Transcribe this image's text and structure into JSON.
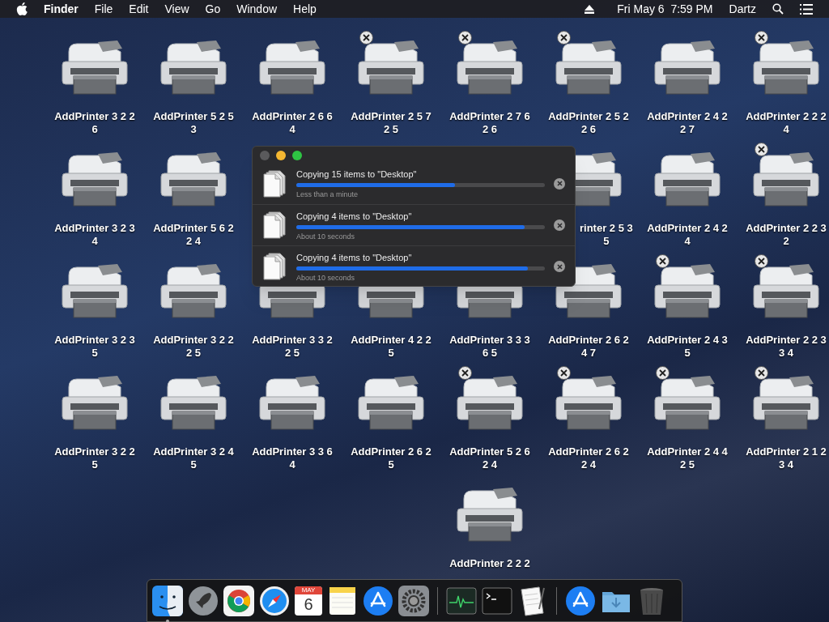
{
  "menu_bar": {
    "app": "Finder",
    "items": [
      "File",
      "Edit",
      "View",
      "Go",
      "Window",
      "Help"
    ],
    "clock": "Fri May 6  7:59 PM",
    "user": "Dartz"
  },
  "desktop": {
    "rows": [
      [
        {
          "label": [
            "AddPrinter 3 2 2",
            "6"
          ],
          "close_badge": false
        },
        {
          "label": [
            "AddPrinter 5 2 5",
            "3"
          ],
          "close_badge": false
        },
        {
          "label": [
            "AddPrinter 2 6 6",
            "4"
          ],
          "close_badge": false
        },
        {
          "label": [
            "AddPrinter 2 5 7",
            "2 5"
          ],
          "close_badge": true
        },
        {
          "label": [
            "AddPrinter 2 7 6",
            "2 6"
          ],
          "close_badge": true
        },
        {
          "label": [
            "AddPrinter 2 5 2",
            "2 6"
          ],
          "close_badge": true
        },
        {
          "label": [
            "AddPrinter 2 4 2",
            "2 7"
          ],
          "close_badge": false
        },
        {
          "label": [
            "AddPrinter 2 2 2",
            "4"
          ],
          "close_badge": true
        }
      ],
      [
        {
          "label": [
            "AddPrinter 3 2 3",
            "4"
          ],
          "close_badge": false
        },
        {
          "label": [
            "AddPrinter 5 6 2",
            "2 4"
          ],
          "close_badge": false
        },
        null,
        null,
        null,
        {
          "label": [
            "rinter 2 5 3",
            "5"
          ],
          "close_badge": false
        },
        {
          "label": [
            "AddPrinter 2 4 2",
            "4"
          ],
          "close_badge": false
        },
        {
          "label": [
            "AddPrinter 2 2 3",
            "2"
          ],
          "close_badge": true
        }
      ],
      [
        {
          "label": [
            "AddPrinter 3 2 3",
            "5"
          ],
          "close_badge": false
        },
        {
          "label": [
            "AddPrinter 3 2 2",
            "2 5"
          ],
          "close_badge": false
        },
        {
          "label": [
            "AddPrinter 3 3 2",
            "2 5"
          ],
          "close_badge": false
        },
        {
          "label": [
            "AddPrinter 4 2 2",
            "5"
          ],
          "close_badge": false
        },
        {
          "label": [
            "AddPrinter 3 3 3",
            "6 5"
          ],
          "close_badge": false
        },
        {
          "label": [
            "AddPrinter 2 6 2",
            "4 7"
          ],
          "close_badge": false
        },
        {
          "label": [
            "AddPrinter 2 4 3",
            "5"
          ],
          "close_badge": true
        },
        {
          "label": [
            "AddPrinter 2 2 3",
            "3 4"
          ],
          "close_badge": true
        }
      ],
      [
        {
          "label": [
            "AddPrinter 3 2 2",
            "5"
          ],
          "close_badge": false
        },
        {
          "label": [
            "AddPrinter 3 2 4",
            "5"
          ],
          "close_badge": false
        },
        {
          "label": [
            "AddPrinter 3 3 6",
            "4"
          ],
          "close_badge": false
        },
        {
          "label": [
            "AddPrinter 2 6 2",
            "5"
          ],
          "close_badge": false
        },
        {
          "label": [
            "AddPrinter 5 2 6",
            "2 4"
          ],
          "close_badge": true
        },
        {
          "label": [
            "AddPrinter 2 6 2",
            "2 4"
          ],
          "close_badge": true
        },
        {
          "label": [
            "AddPrinter 2 4 4",
            "2 5"
          ],
          "close_badge": true
        },
        {
          "label": [
            "AddPrinter 2 1 2",
            "3 4"
          ],
          "close_badge": true
        }
      ],
      [
        null,
        null,
        null,
        null,
        {
          "label": [
            "AddPrinter 2 2 2"
          ],
          "close_badge": false
        }
      ]
    ]
  },
  "copy_dialog": {
    "items": [
      {
        "title": "Copying 15 items to \"Desktop\"",
        "level": 0.64,
        "eta": "Less than a minute"
      },
      {
        "title": "Copying 4 items to \"Desktop\"",
        "level": 0.92,
        "eta": "About 10 seconds"
      },
      {
        "title": "Copying 4 items to \"Desktop\"",
        "level": 0.93,
        "eta": "About 10 seconds"
      }
    ]
  },
  "dock": {
    "items": [
      {
        "kind": "finder",
        "running": true
      },
      {
        "kind": "launchpad",
        "running": false
      },
      {
        "kind": "chrome",
        "running": false
      },
      {
        "kind": "safari",
        "running": false
      },
      {
        "kind": "calendar",
        "running": false,
        "month": "MAY",
        "day": "6"
      },
      {
        "kind": "notes",
        "running": false
      },
      {
        "kind": "appstore",
        "running": false
      },
      {
        "kind": "prefs",
        "running": false
      },
      {
        "kind": "separator"
      },
      {
        "kind": "monitor",
        "running": false
      },
      {
        "kind": "terminal",
        "running": false
      },
      {
        "kind": "textedit",
        "running": false
      },
      {
        "kind": "separator"
      },
      {
        "kind": "appstore",
        "running": false
      },
      {
        "kind": "downloads",
        "running": false
      },
      {
        "kind": "trash",
        "running": false
      }
    ]
  }
}
